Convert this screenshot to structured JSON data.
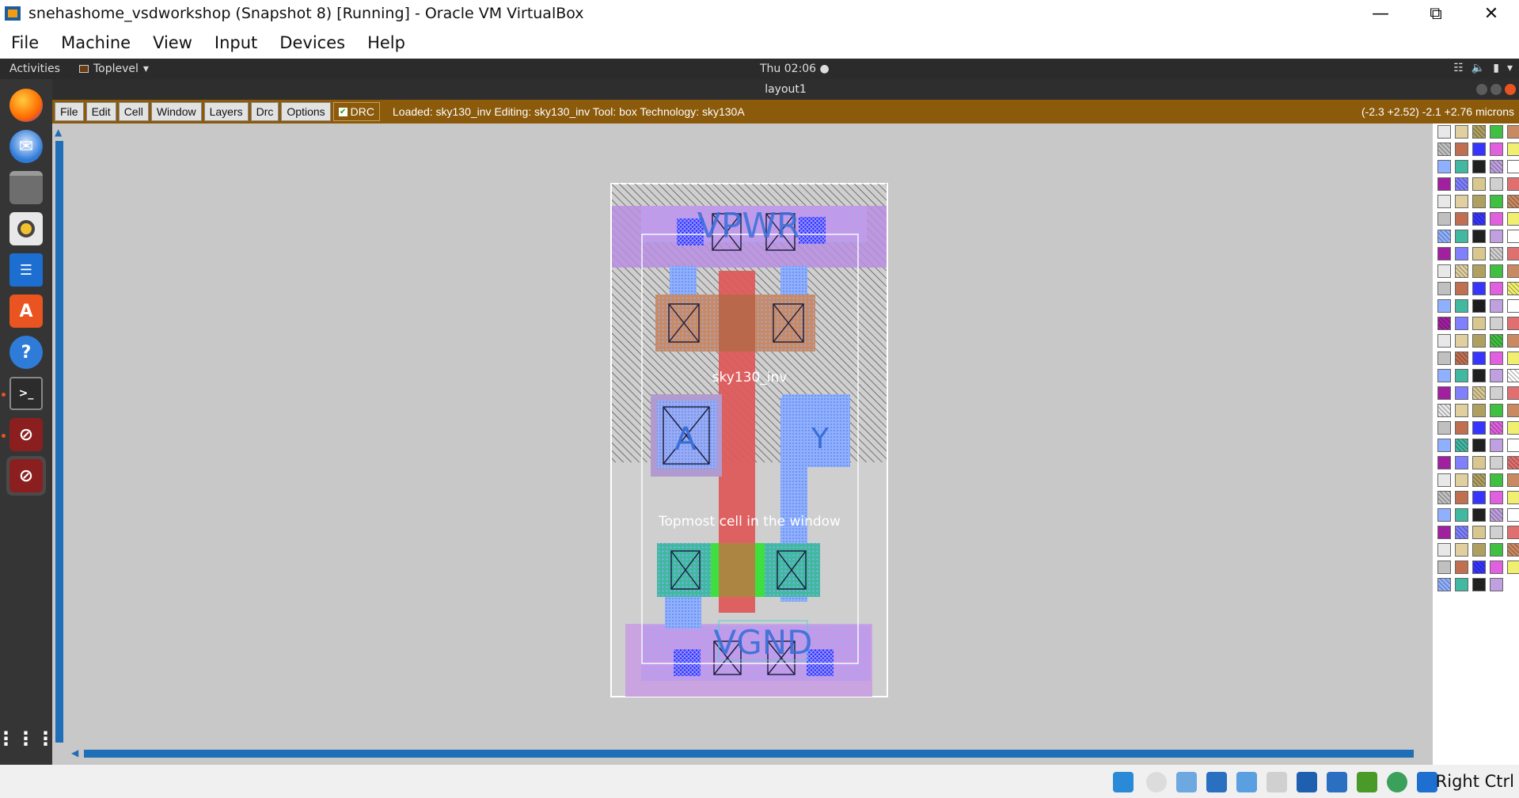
{
  "host": {
    "window_title": "snehashome_vsdworkshop (Snapshot 8) [Running] - Oracle VM VirtualBox",
    "menu": [
      "File",
      "Machine",
      "View",
      "Input",
      "Devices",
      "Help"
    ],
    "host_key": "Right Ctrl"
  },
  "gnome": {
    "activities": "Activities",
    "app_menu": "Toplevel",
    "clock": "Thu 02:06"
  },
  "magic": {
    "window_title": "layout1",
    "menu": [
      "File",
      "Edit",
      "Cell",
      "Window",
      "Layers",
      "Drc",
      "Options"
    ],
    "drc_label": "DRC",
    "status": "Loaded: sky130_inv  Editing: sky130_inv  Tool: box   Technology: sky130A",
    "coords": "(-2.3 +2.52) -2.1 +2.76 microns"
  },
  "layout": {
    "cell_name": "sky130_inv",
    "pin_vpwr": "VPWR",
    "pin_vgnd": "VGND",
    "pin_a": "A",
    "pin_y": "Y",
    "cell_note": "Topmost cell in the window"
  },
  "colors": {
    "magic_bar": "#8b5a0b",
    "nwell_hatch": "#5a5a5a",
    "poly": "#e05050",
    "li": "#8fb0ff",
    "metal1": "#b794d6",
    "diff_n": "#3fbf3f",
    "scroll": "#1e6fb8"
  }
}
